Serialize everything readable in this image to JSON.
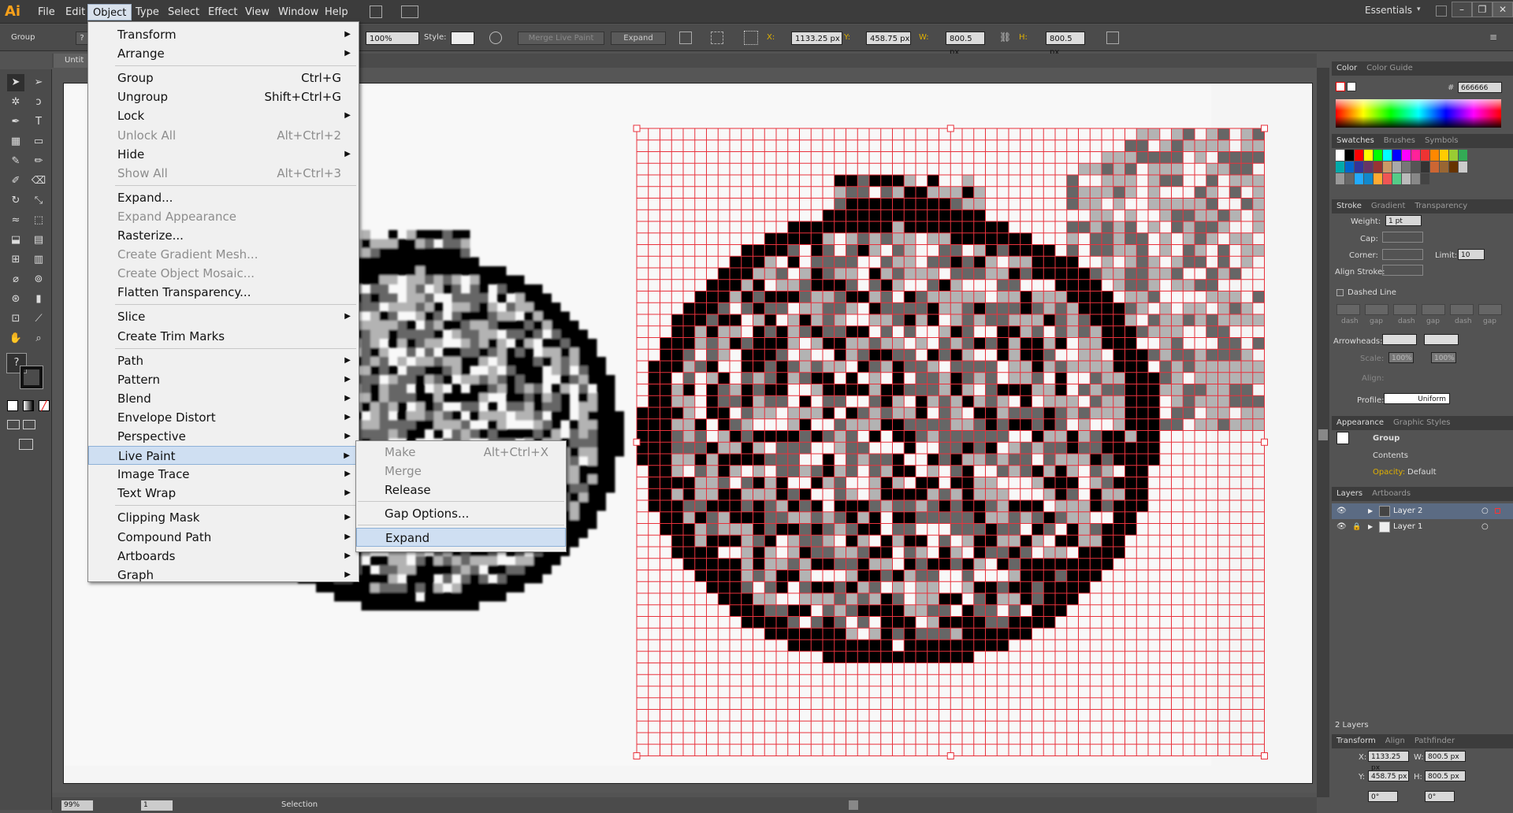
{
  "app": {
    "logo": "Ai",
    "workspace": "Essentials"
  },
  "menubar": {
    "items": [
      "File",
      "Edit",
      "Object",
      "Type",
      "Select",
      "Effect",
      "View",
      "Window",
      "Help"
    ],
    "active": "Object"
  },
  "controlbar": {
    "selection_label": "Group",
    "opacity": "100%",
    "style_label": "Style:",
    "merge_live_paint": "Merge Live Paint",
    "expand": "Expand",
    "x_label": "X:",
    "x_value": "1133.25 px",
    "y_label": "Y:",
    "y_value": "458.75 px",
    "w_label": "W:",
    "w_value": "800.5 px",
    "h_label": "H:",
    "h_value": "800.5 px"
  },
  "document": {
    "tab_title": "Untit"
  },
  "object_menu": {
    "items": [
      {
        "label": "Transform",
        "shortcut": "",
        "submenu": true,
        "disabled": false
      },
      {
        "label": "Arrange",
        "shortcut": "",
        "submenu": true,
        "disabled": false
      },
      {
        "sep": true
      },
      {
        "label": "Group",
        "shortcut": "Ctrl+G",
        "submenu": false,
        "disabled": false
      },
      {
        "label": "Ungroup",
        "shortcut": "Shift+Ctrl+G",
        "submenu": false,
        "disabled": false
      },
      {
        "label": "Lock",
        "shortcut": "",
        "submenu": true,
        "disabled": false
      },
      {
        "label": "Unlock All",
        "shortcut": "Alt+Ctrl+2",
        "submenu": false,
        "disabled": true
      },
      {
        "label": "Hide",
        "shortcut": "",
        "submenu": true,
        "disabled": false
      },
      {
        "label": "Show All",
        "shortcut": "Alt+Ctrl+3",
        "submenu": false,
        "disabled": true
      },
      {
        "sep": true
      },
      {
        "label": "Expand...",
        "shortcut": "",
        "submenu": false,
        "disabled": false
      },
      {
        "label": "Expand Appearance",
        "shortcut": "",
        "submenu": false,
        "disabled": true
      },
      {
        "label": "Rasterize...",
        "shortcut": "",
        "submenu": false,
        "disabled": false
      },
      {
        "label": "Create Gradient Mesh...",
        "shortcut": "",
        "submenu": false,
        "disabled": true
      },
      {
        "label": "Create Object Mosaic...",
        "shortcut": "",
        "submenu": false,
        "disabled": true
      },
      {
        "label": "Flatten Transparency...",
        "shortcut": "",
        "submenu": false,
        "disabled": false
      },
      {
        "sep": true
      },
      {
        "label": "Slice",
        "shortcut": "",
        "submenu": true,
        "disabled": false
      },
      {
        "label": "Create Trim Marks",
        "shortcut": "",
        "submenu": false,
        "disabled": false
      },
      {
        "sep": true
      },
      {
        "label": "Path",
        "shortcut": "",
        "submenu": true,
        "disabled": false
      },
      {
        "label": "Pattern",
        "shortcut": "",
        "submenu": true,
        "disabled": false
      },
      {
        "label": "Blend",
        "shortcut": "",
        "submenu": true,
        "disabled": false
      },
      {
        "label": "Envelope Distort",
        "shortcut": "",
        "submenu": true,
        "disabled": false
      },
      {
        "label": "Perspective",
        "shortcut": "",
        "submenu": true,
        "disabled": false
      },
      {
        "label": "Live Paint",
        "shortcut": "",
        "submenu": true,
        "disabled": false,
        "highlighted": true
      },
      {
        "label": "Image Trace",
        "shortcut": "",
        "submenu": true,
        "disabled": false
      },
      {
        "label": "Text Wrap",
        "shortcut": "",
        "submenu": true,
        "disabled": false
      },
      {
        "sep": true
      },
      {
        "label": "Clipping Mask",
        "shortcut": "",
        "submenu": true,
        "disabled": false
      },
      {
        "label": "Compound Path",
        "shortcut": "",
        "submenu": true,
        "disabled": false
      },
      {
        "label": "Artboards",
        "shortcut": "",
        "submenu": true,
        "disabled": false
      },
      {
        "label": "Graph",
        "shortcut": "",
        "submenu": true,
        "disabled": false
      }
    ]
  },
  "live_paint_submenu": {
    "items": [
      {
        "label": "Make",
        "shortcut": "Alt+Ctrl+X",
        "disabled": true
      },
      {
        "label": "Merge",
        "shortcut": "",
        "disabled": true
      },
      {
        "label": "Release",
        "shortcut": "",
        "disabled": false
      },
      {
        "sep": true
      },
      {
        "label": "Gap Options...",
        "shortcut": "",
        "disabled": false
      },
      {
        "sep": true
      },
      {
        "label": "Expand",
        "shortcut": "",
        "disabled": false,
        "highlighted": true
      }
    ]
  },
  "panels": {
    "color": {
      "tab": "Color",
      "tab2": "Color Guide",
      "hex": "666666"
    },
    "swatches": {
      "tabs": [
        "Swatches",
        "Brushes",
        "Symbols"
      ]
    },
    "stroke": {
      "tabs": [
        "Stroke",
        "Gradient",
        "Transparency"
      ],
      "weight_label": "Weight:",
      "weight": "1 pt",
      "cap_label": "Cap:",
      "corner_label": "Corner:",
      "limit_label": "Limit:",
      "limit": "10",
      "align_label": "Align Stroke:",
      "dashed_label": "Dashed Line",
      "dash_labels": [
        "dash",
        "gap",
        "dash",
        "gap",
        "dash",
        "gap"
      ],
      "arrowheads_label": "Arrowheads:",
      "scale_label": "Scale:",
      "scale1": "100%",
      "scale2": "100%",
      "align2_label": "Align:",
      "profile_label": "Profile:",
      "profile": "Uniform"
    },
    "appearance": {
      "tabs": [
        "Appearance",
        "Graphic Styles"
      ],
      "title": "Group",
      "contents": "Contents",
      "opacity_label": "Opacity:",
      "opacity": "Default"
    },
    "layers": {
      "tabs": [
        "Layers",
        "Artboards"
      ],
      "layers": [
        "Layer 2",
        "Layer 1"
      ],
      "count": "2 Layers"
    },
    "transform": {
      "tabs": [
        "Transform",
        "Align",
        "Pathfinder"
      ],
      "x_label": "X:",
      "x": "1133.25 px",
      "y_label": "Y:",
      "y": "458.75 px",
      "w_label": "W:",
      "w": "800.5 px",
      "h_label": "H:",
      "h": "800.5 px",
      "angle1": "0°",
      "angle2": "0°"
    }
  },
  "status": {
    "zoom": "99%",
    "artboard_num": "1",
    "mode": "Selection"
  }
}
